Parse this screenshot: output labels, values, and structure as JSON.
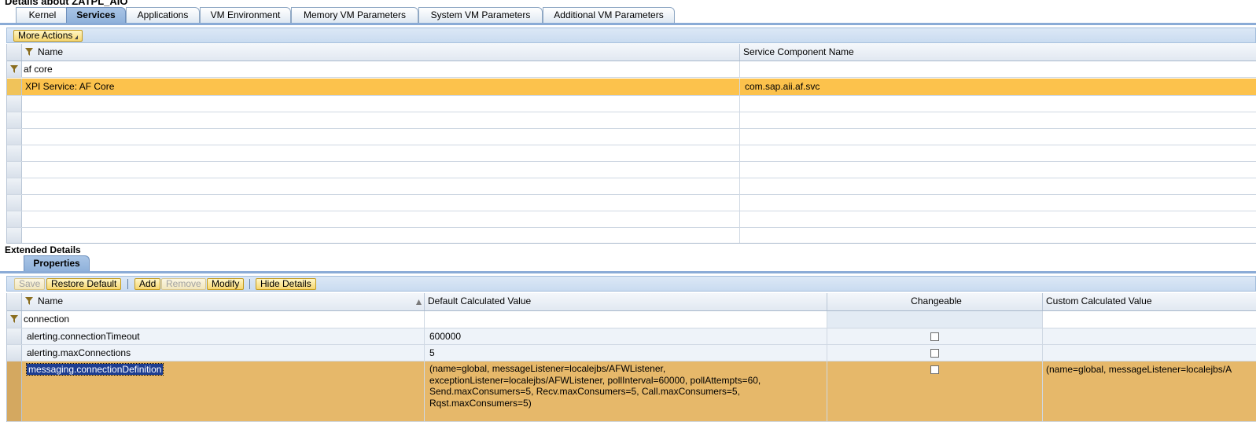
{
  "page_title": "Details about ZATPL_AIO",
  "tabs": [
    "Kernel",
    "Services",
    "Applications",
    "VM Environment",
    "Memory VM Parameters",
    "System VM Parameters",
    "Additional VM Parameters"
  ],
  "active_tab": "Services",
  "services": {
    "more_actions_label": "More Actions",
    "columns": [
      "Name",
      "Service Component Name"
    ],
    "filter_value": "af core",
    "rows": [
      {
        "name": "XPI Service: AF Core",
        "component": "com.sap.aii.af.svc",
        "selected": true
      }
    ]
  },
  "extended_details": {
    "title": "Extended Details",
    "tab": "Properties",
    "toolbar": {
      "save": "Save",
      "restore_default": "Restore Default",
      "add": "Add",
      "remove": "Remove",
      "modify": "Modify",
      "hide_details": "Hide Details"
    },
    "columns": [
      "Name",
      "Default Calculated Value",
      "Changeable",
      "Custom Calculated Value"
    ],
    "filter_value": "connection",
    "rows": [
      {
        "name": "alerting.connectionTimeout",
        "default": "600000",
        "changeable": false,
        "custom": ""
      },
      {
        "name": "alerting.maxConnections",
        "default": "5",
        "changeable": false,
        "custom": ""
      },
      {
        "name": "messaging.connectionDefinition",
        "default": "(name=global, messageListener=localejbs/AFWListener, exceptionListener=localejbs/AFWListener, pollInterval=60000, pollAttempts=60, Send.maxConsumers=5, Recv.maxConsumers=5, Call.maxConsumers=5, Rqst.maxConsumers=5)",
        "changeable": false,
        "custom": "(name=global, messageListener=localejbs/A"
      }
    ]
  },
  "colors": {
    "selected_row": "#fcc24c",
    "selected_row_detail": "#e6b86a",
    "button_fill": "#f6d670",
    "tab_active": "#8eb0da"
  },
  "icons": {
    "filter": "filter-funnel-icon",
    "sort": "sort-ascending-icon",
    "dropdown": "dropdown-caret-icon"
  }
}
